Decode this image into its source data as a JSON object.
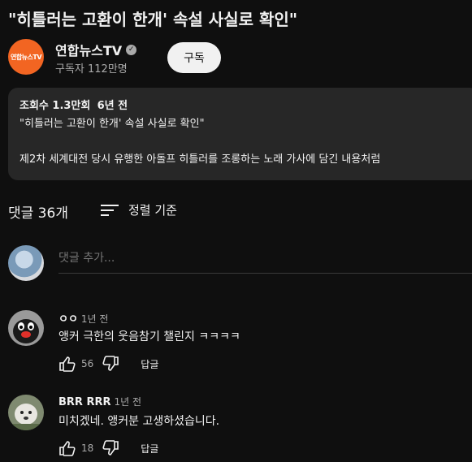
{
  "video": {
    "title": "\"히틀러는 고환이 한개' 속설 사실로 확인\""
  },
  "channel": {
    "avatar_text": "연합뉴스TV",
    "name": "연합뉴스TV",
    "subscribers": "구독자 112만명",
    "subscribe_label": "구독"
  },
  "description": {
    "views": "조회수 1.3만회",
    "age": "6년 전",
    "line2": "\"히틀러는 고환이 한개' 속설 사실로 확인\"",
    "line3": "제2차 세계대전 당시 유행한 아돌프 히틀러를 조롱하는 노래 가사에 담긴 내용처럼"
  },
  "comments_header": {
    "count": "댓글 36개",
    "sort_label": "정렬 기준"
  },
  "add_comment": {
    "placeholder": "댓글 추가..."
  },
  "comments": [
    {
      "author": "ㅇㅇ",
      "time": "1년 전",
      "text": "앵커 극한의 웃음참기 챌린지 ㅋㅋㅋㅋ",
      "likes": "56",
      "reply_label": "답글"
    },
    {
      "author": "BRR RRR",
      "time": "1년 전",
      "text": "미치겠네. 앵커분 고생하셨습니다.",
      "likes": "18",
      "reply_label": "답글"
    }
  ],
  "colors": {
    "background": "#0f0f0f",
    "card": "#272727",
    "brand": "#f26522"
  }
}
